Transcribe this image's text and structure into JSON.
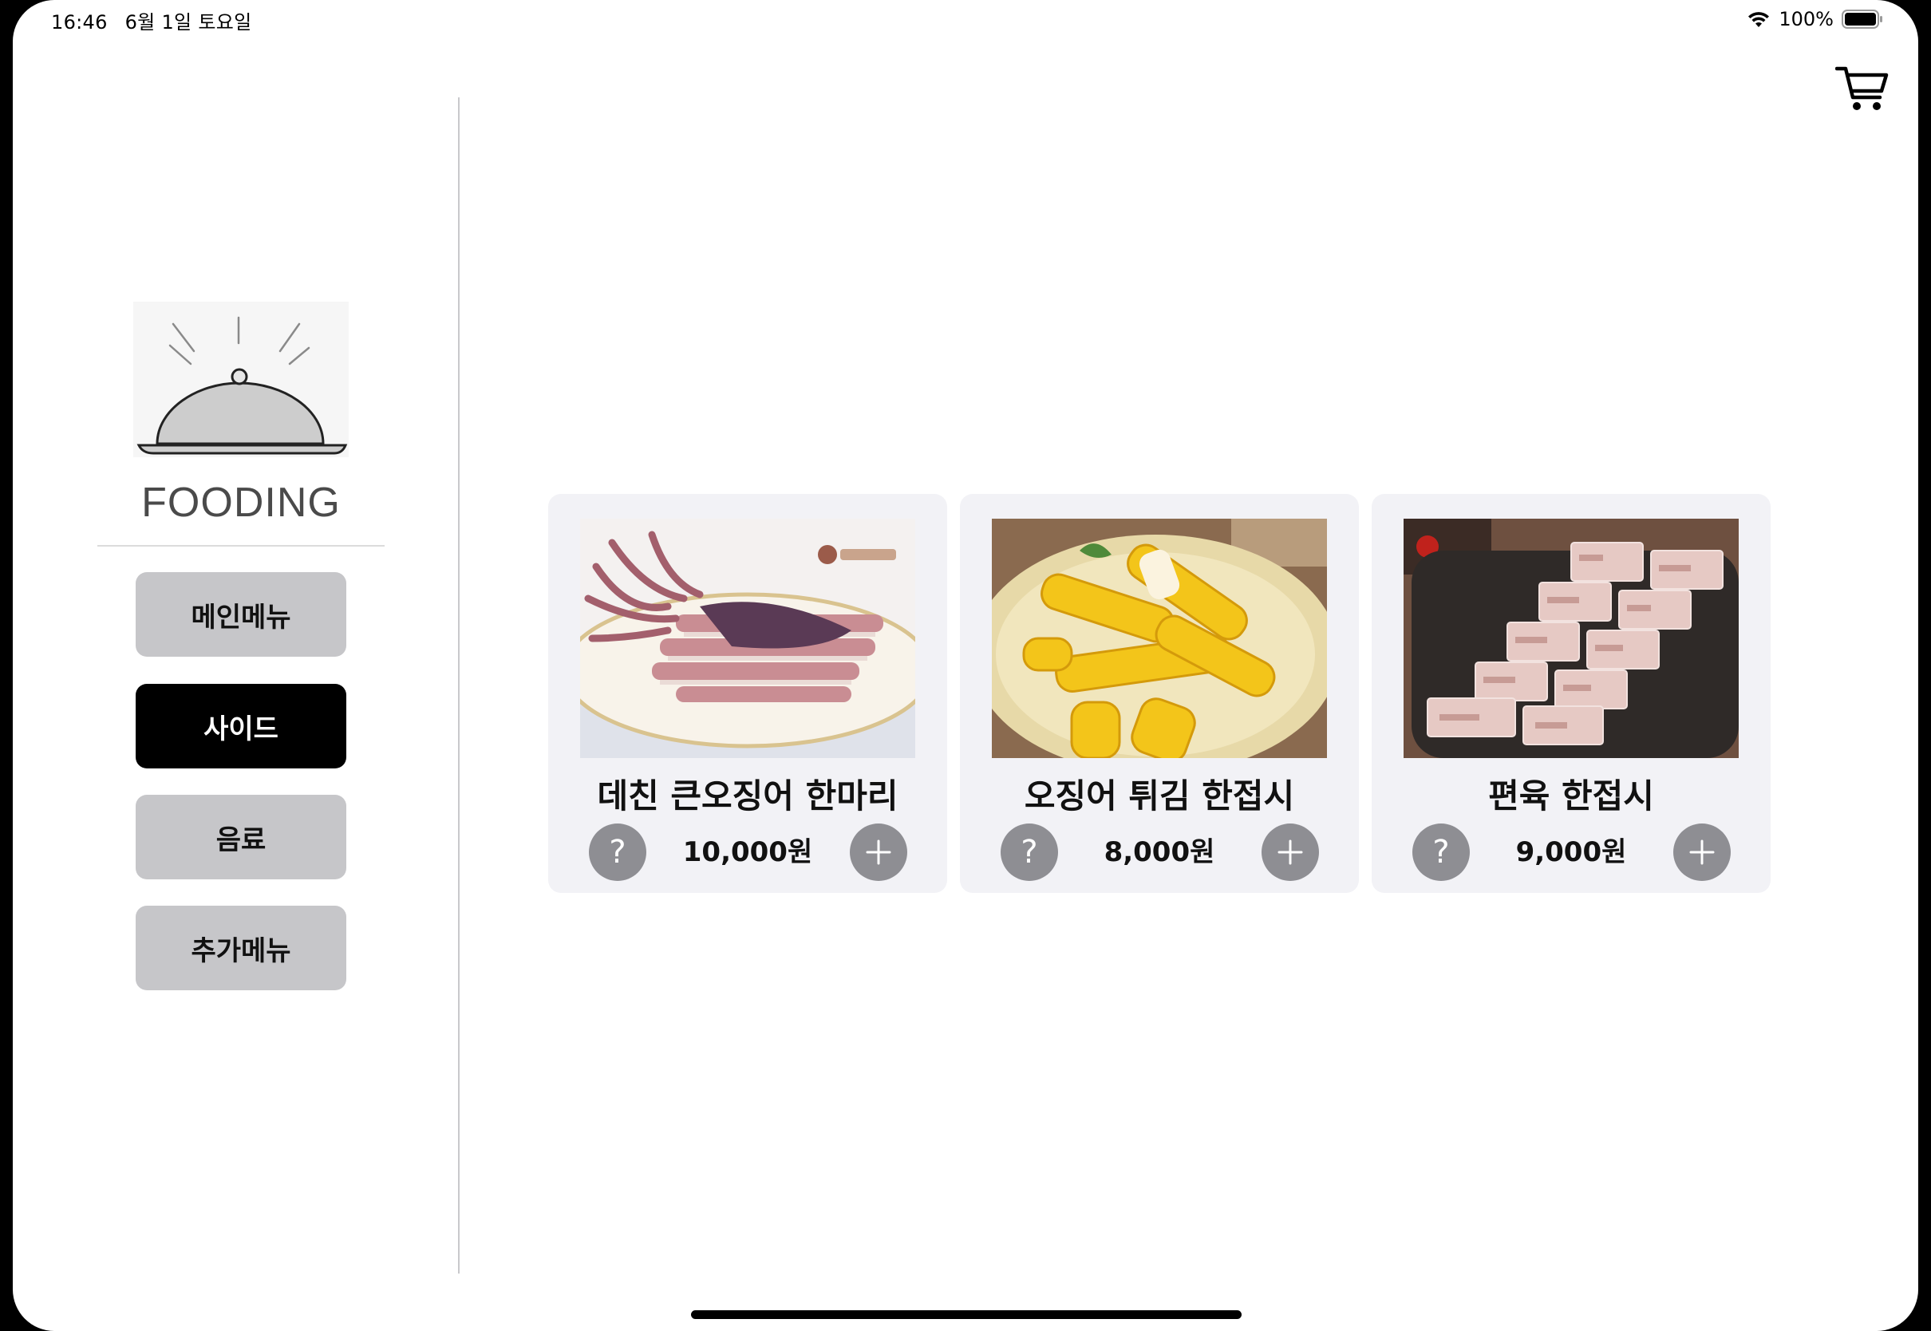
{
  "status_bar": {
    "time": "16:46",
    "date": "6월 1일 토요일",
    "battery": "100%"
  },
  "brand": {
    "name": "FOODING",
    "logo_icon": "cloche-icon"
  },
  "categories": [
    {
      "label": "메인메뉴",
      "active": false
    },
    {
      "label": "사이드",
      "active": true
    },
    {
      "label": "음료",
      "active": false
    },
    {
      "label": "추가메뉴",
      "active": false
    }
  ],
  "products": [
    {
      "name": "데친 큰오징어 한마리",
      "price": "10,000원",
      "image_icon": "blanched-squid-photo"
    },
    {
      "name": "오징어 튀김 한접시",
      "price": "8,000원",
      "image_icon": "fried-squid-photo"
    },
    {
      "name": "편육 한접시",
      "price": "9,000원",
      "image_icon": "pressed-pork-photo"
    }
  ],
  "buttons": {
    "info_label": "?",
    "add_symbol": "plus-icon"
  },
  "colors": {
    "active_category": "#000000",
    "inactive_category": "#c6c6c9",
    "card_background": "#f2f2f6",
    "round_button": "#8e8e93"
  }
}
